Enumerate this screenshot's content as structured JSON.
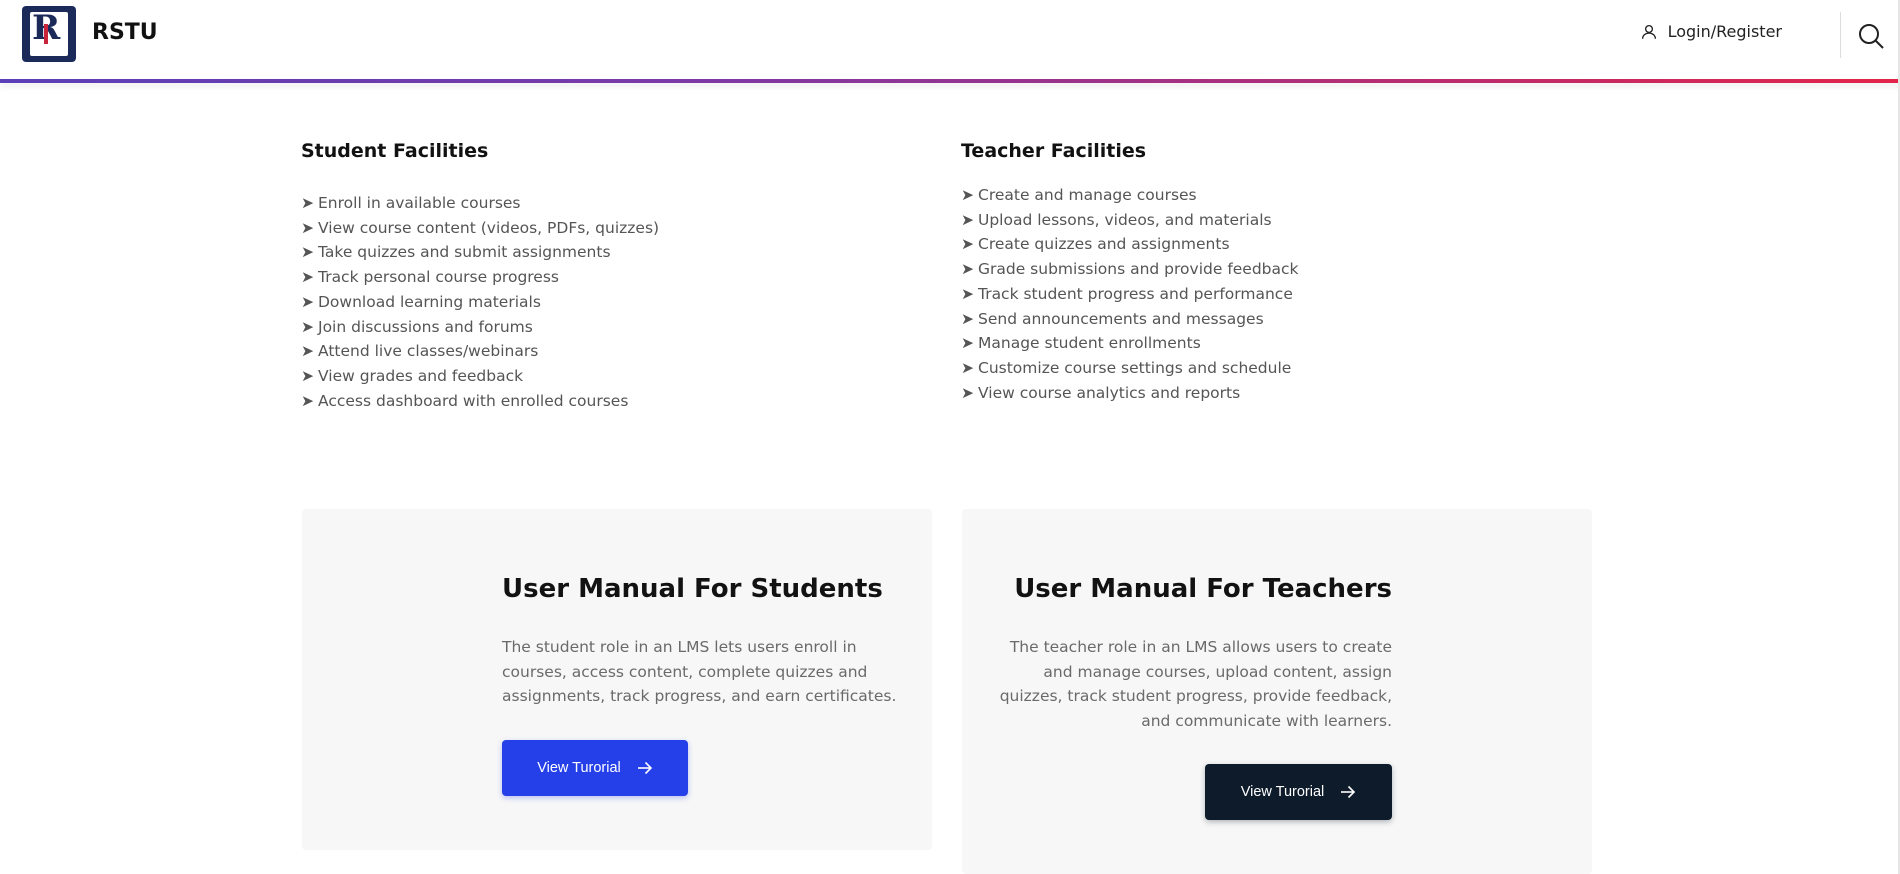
{
  "header": {
    "brand": "RSTU",
    "logo_letters": "R",
    "login_label": "Login/Register",
    "accent_gradient": [
      "#5b3fb6",
      "#e2244a"
    ]
  },
  "icons": {
    "user": "user-icon",
    "search": "search-icon",
    "arrow": "arrow-right-icon"
  },
  "student_facilities": {
    "title": "Student Facilities",
    "items": [
      "Enroll in available courses",
      "View course content (videos, PDFs, quizzes)",
      "Take quizzes and submit assignments",
      "Track personal course progress",
      "Download learning materials",
      "Join discussions and forums",
      "Attend live classes/webinars",
      "View grades and feedback",
      "Access dashboard with enrolled courses"
    ]
  },
  "teacher_facilities": {
    "title": "Teacher Facilities",
    "items": [
      "Create and manage courses",
      "Upload lessons, videos, and materials",
      "Create quizzes and assignments",
      "Grade submissions and provide feedback",
      "Track student progress and performance",
      "Send announcements and messages",
      "Manage student enrollments",
      "Customize course settings and schedule",
      "View course analytics and reports"
    ]
  },
  "bullet_char": "➤",
  "manuals": {
    "students": {
      "title": "User Manual For Students",
      "description": "The student role in an LMS lets users enroll in courses, access content, complete quizzes and assignments, track progress, and earn certificates.",
      "button_label": "View Turorial",
      "button_color": "#2540e8"
    },
    "teachers": {
      "title": "User Manual For Teachers",
      "description": "The teacher role in an LMS allows users to create and manage courses, upload content, assign quizzes, track student progress, provide feedback, and communicate with learners.",
      "button_label": "View Turorial",
      "button_color": "#0d1b2a"
    }
  }
}
